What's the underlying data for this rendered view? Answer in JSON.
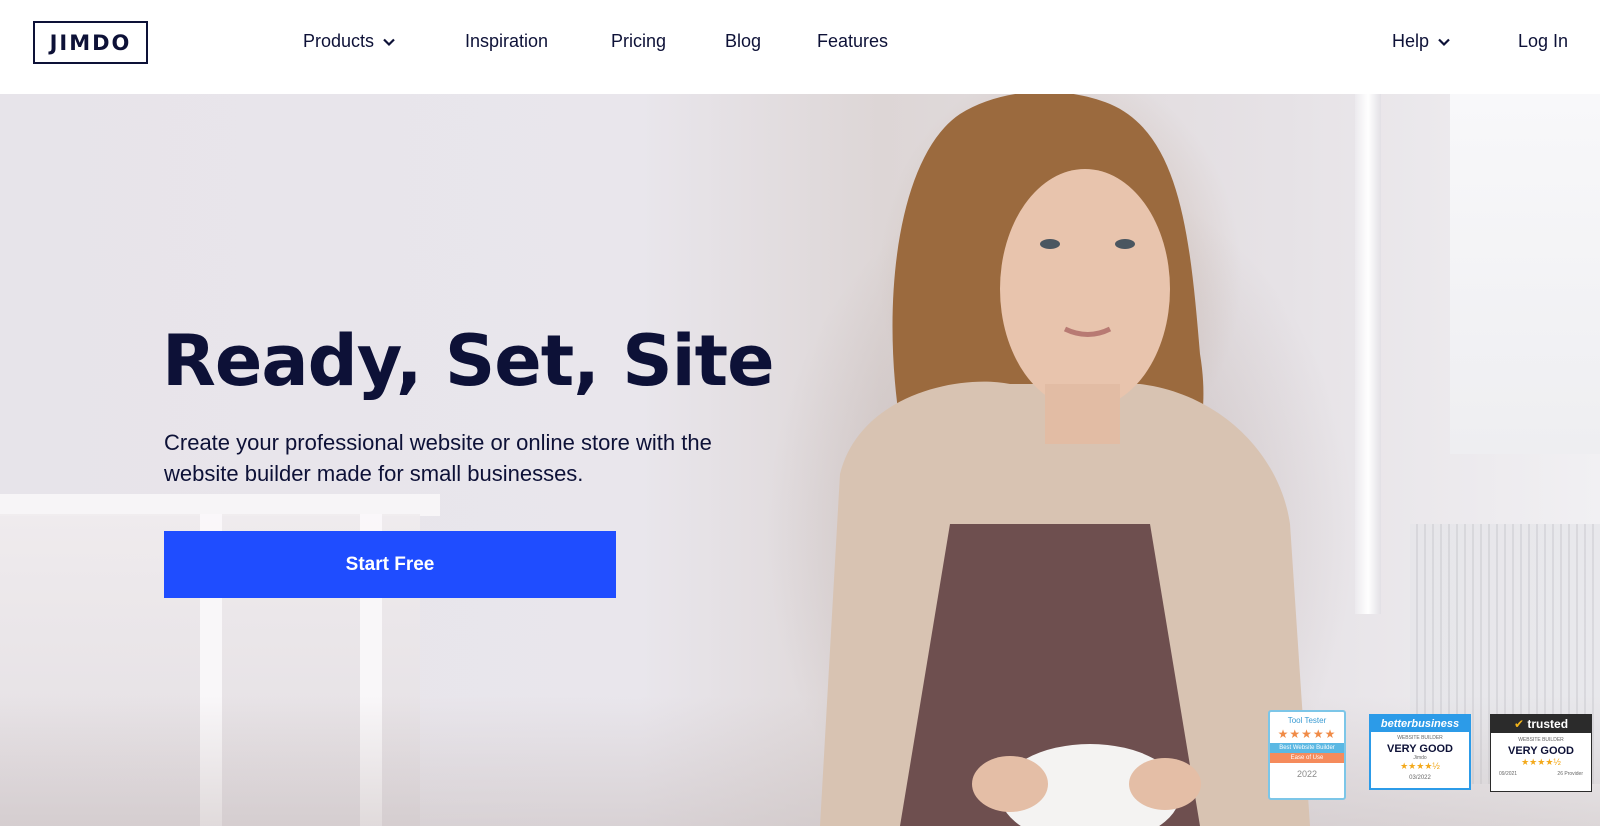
{
  "brand": {
    "logo_text": "JIMDO"
  },
  "nav": {
    "products": "Products",
    "inspiration": "Inspiration",
    "pricing": "Pricing",
    "blog": "Blog",
    "features": "Features",
    "help": "Help",
    "login": "Log In"
  },
  "hero": {
    "headline": "Ready, Set, Site",
    "subtext": "Create your professional website or online store with the website builder made for small businesses.",
    "cta_label": "Start Free",
    "cta_color": "#1f4dff",
    "text_color": "#0d1137"
  },
  "badges": {
    "tooltester": {
      "brand": "Tool Tester",
      "rating_stars": 5,
      "title": "Best Website Builder",
      "subtitle": "Ease of Use",
      "year": "2022"
    },
    "betterbusiness": {
      "brand": "betterbusiness",
      "category": "WEBSITE BUILDER",
      "verdict": "VERY GOOD",
      "rating_stars": 4.5,
      "site": "Jimdo",
      "date": "03/2022"
    },
    "trusted": {
      "brand": "trusted",
      "category": "WEBSITE BUILDER",
      "verdict": "VERY GOOD",
      "rating_stars": 4.5,
      "date": "09/2021",
      "providers": "26 Provider"
    }
  }
}
